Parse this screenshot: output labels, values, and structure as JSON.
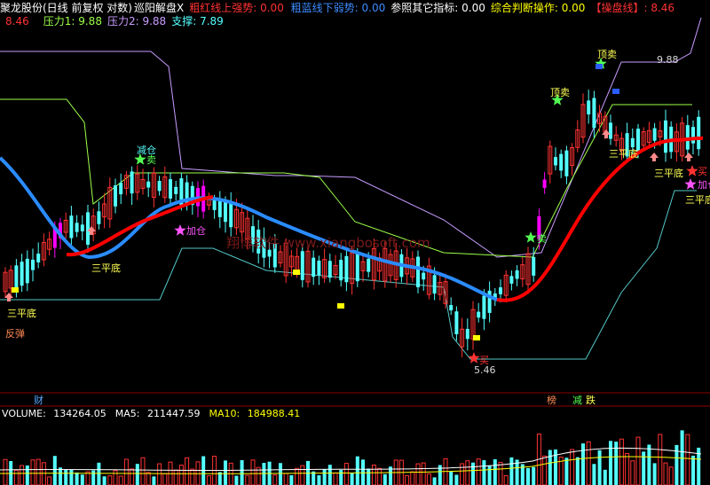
{
  "header": {
    "title": "聚龙股份(日线 前复权 对数)",
    "indicator": "巡阳解盘X",
    "red_label": "粗红线上强势:",
    "red_value": "0.00",
    "blue_label": "粗蓝线下弱势:",
    "blue_value": "0.00",
    "ref_label": "参照其它指标:",
    "ref_value": "0.00",
    "judge_label": "综合判断操作:",
    "judge_value": "0.00",
    "op_label": "【操盘线】:",
    "op_value": "8.46",
    "line2_value": "8.46",
    "p1_label": "压力1:",
    "p1_value": "9.88",
    "p2_label": "压力2:",
    "p2_value": "9.88",
    "support_label": "支撑:",
    "support_value": "7.89"
  },
  "volume_header": {
    "volume_label": "VOLUME:",
    "volume_value": "134264.05",
    "ma5_label": "MA5:",
    "ma5_value": "211447.59",
    "ma10_label": "MA10:",
    "ma10_value": "184988.41"
  },
  "colors": {
    "up": "#ff3232",
    "down": "#54ffff",
    "strong": "#ff00ff",
    "red_line": "#ff0000",
    "blue_line": "#2a8cff",
    "support": "#54c8c8",
    "pressure1": "#9cff4a",
    "pressure2": "#c89cff",
    "yellow": "#ffff00"
  },
  "chart_data": {
    "type": "candlestick",
    "price_max": "9.88",
    "price_min": "5.46",
    "signals": {
      "sell1": "减仓",
      "sell1b": "卖",
      "add1": "加仓",
      "bottom1": "三平底",
      "bottom2": "三平底",
      "bottom3": "三平底",
      "bottom4": "三平底",
      "bottom5": "三平底",
      "rebound": "反弹",
      "sell2": "卖",
      "buy1": "买",
      "top1": "顶卖",
      "top2": "顶卖",
      "buy2": "买",
      "add2": "加仓"
    },
    "bottom_tags": {
      "cai": "财",
      "bang": "榜",
      "jian": "减",
      "die": "跌"
    },
    "watermark": "翔博软件 www.xiangbosoft.com"
  }
}
